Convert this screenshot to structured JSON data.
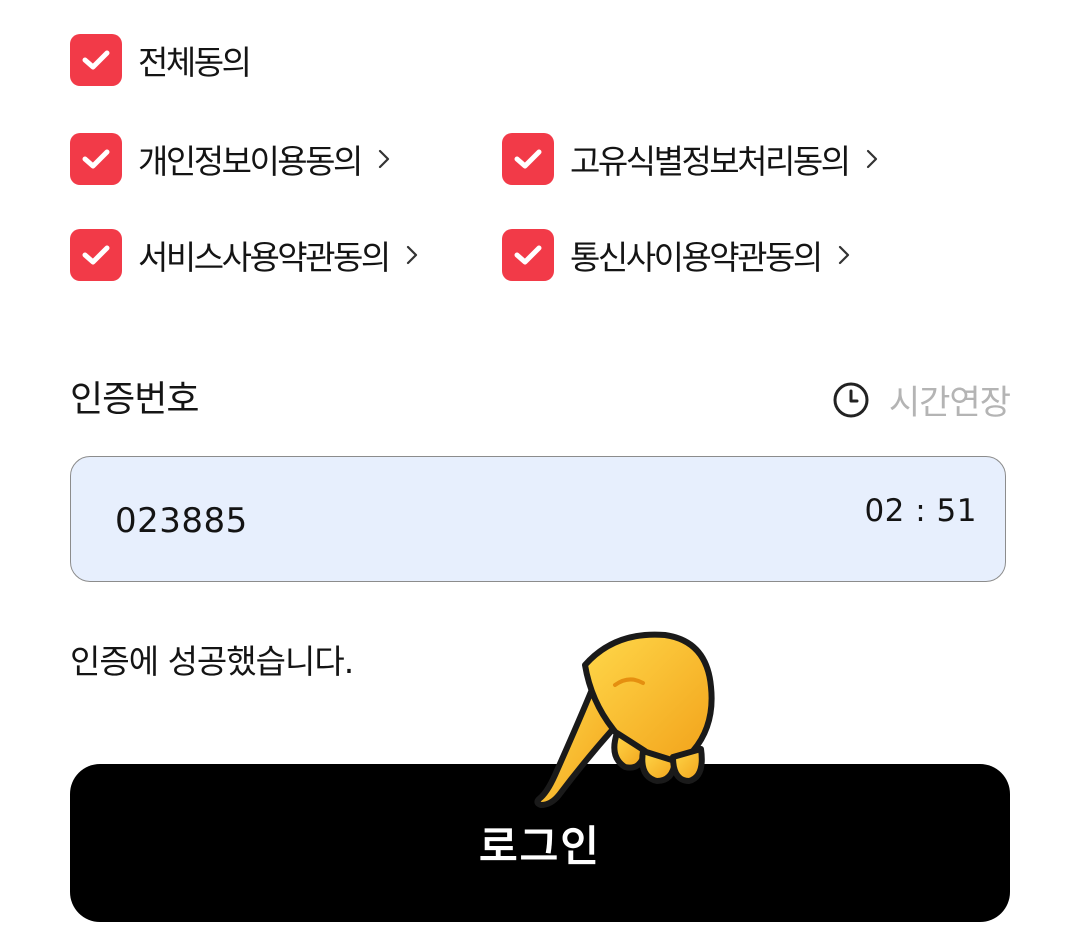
{
  "agreements": {
    "all": {
      "label": "전체동의",
      "checked": true
    },
    "personal_info": {
      "label": "개인정보이용동의",
      "checked": true
    },
    "unique_id": {
      "label": "고유식별정보처리동의",
      "checked": true
    },
    "service_terms": {
      "label": "서비스사용약관동의",
      "checked": true
    },
    "telecom_terms": {
      "label": "통신사이용약관동의",
      "checked": true
    }
  },
  "auth": {
    "label": "인증번호",
    "extend_label": "시간연장",
    "code_value": "023885",
    "timer": "02 : 51",
    "success_message": "인증에 성공했습니다."
  },
  "login_button": {
    "label": "로그인"
  },
  "colors": {
    "checkbox": "#f23a48",
    "field_background": "#e7effd",
    "button_background": "#000000",
    "muted_text": "#b4b4b4"
  },
  "icons": {
    "check": "check-icon",
    "chevron": "chevron-right-icon",
    "clock": "clock-icon",
    "pointer": "pointing-hand-emoji"
  }
}
